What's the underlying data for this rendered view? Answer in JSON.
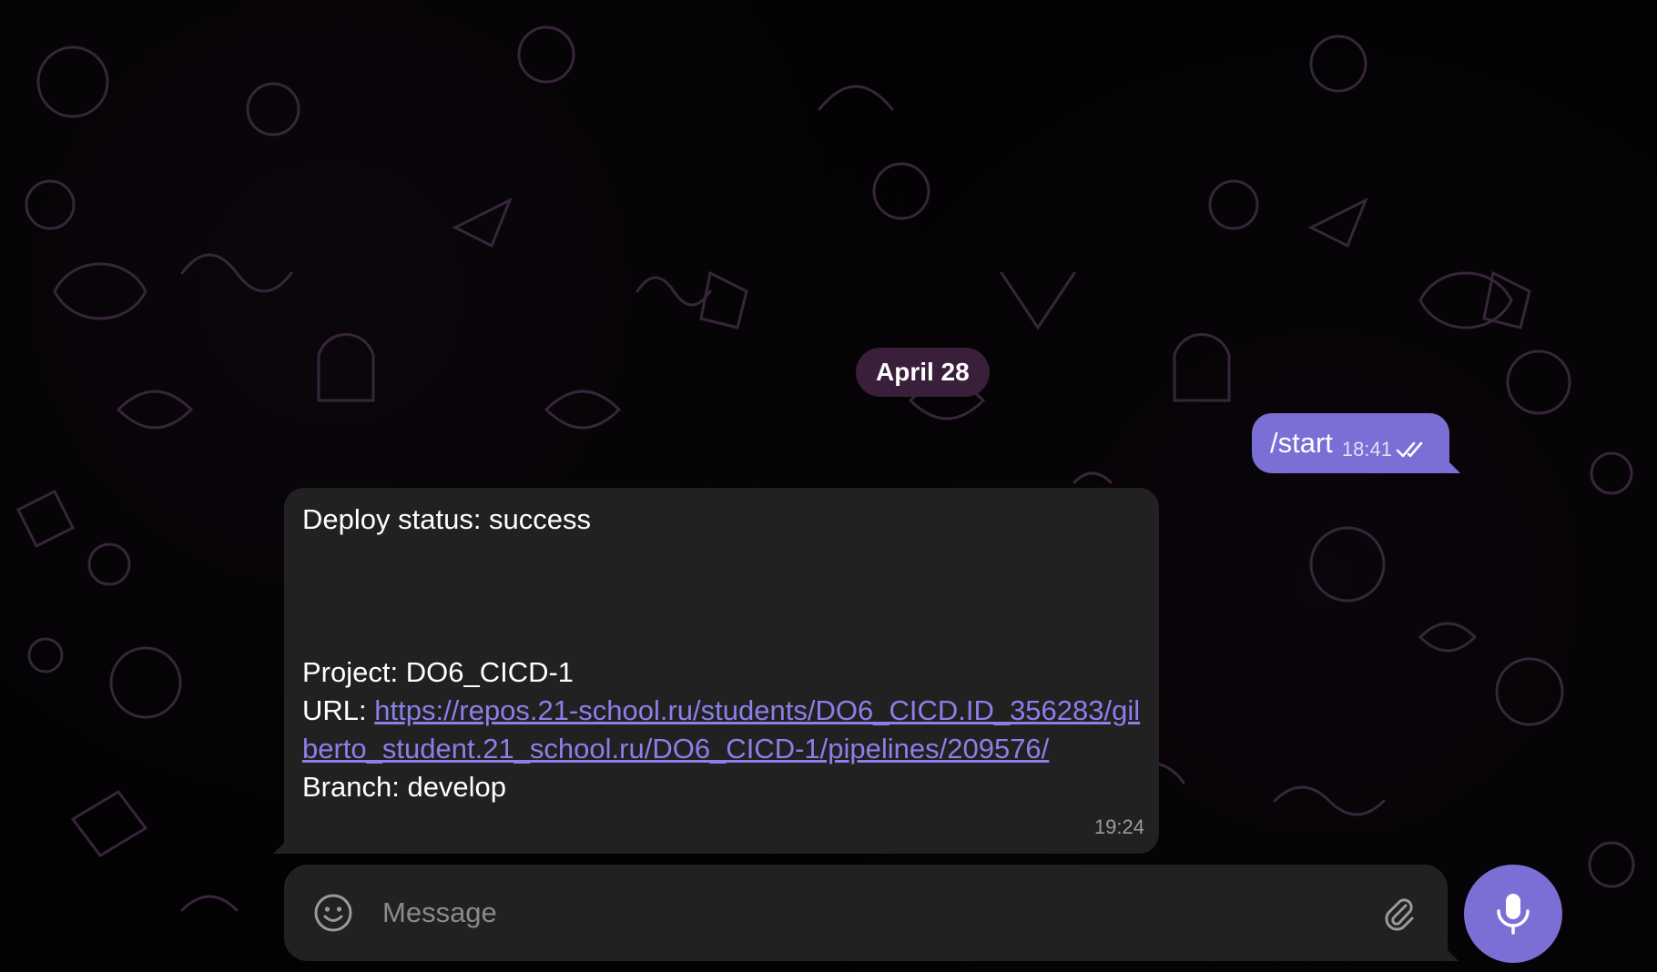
{
  "chat": {
    "date_separator": "April 28",
    "outgoing": {
      "text": "/start",
      "time": "18:41",
      "status_icon": "double-check-icon"
    },
    "incoming": {
      "status_line": "Deploy status: success",
      "project_line": "Project: DO6_CICD-1",
      "url_label": "URL: ",
      "url_link": "https://repos.21-school.ru/students/DO6_CICD.ID_356283/gilberto_student.21_school.ru/DO6_CICD-1/pipelines/209576/",
      "branch_line": "Branch: develop",
      "time": "19:24"
    }
  },
  "composer": {
    "placeholder": "Message",
    "emoji_icon": "emoji-icon",
    "attach_icon": "paperclip-icon",
    "mic_icon": "microphone-icon"
  },
  "colors": {
    "accent": "#7b6fd6",
    "bubble_incoming": "#212121",
    "date_pill": "#3a1f3a",
    "link": "#8b7fe8"
  }
}
